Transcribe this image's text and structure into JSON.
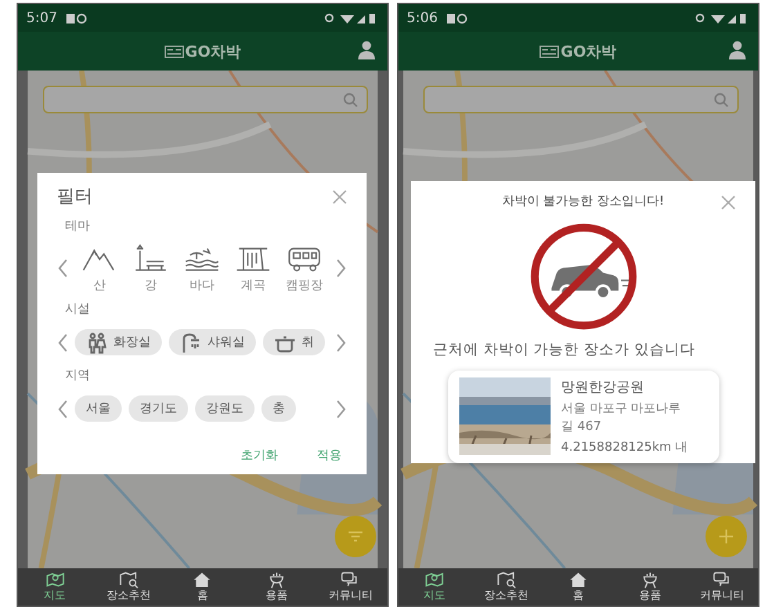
{
  "screens": [
    {
      "status_bar": {
        "time": "5:07"
      },
      "app_bar": {
        "title": "GO차박"
      },
      "fab": {
        "kind": "filter"
      },
      "bottom_nav": [
        {
          "label": "지도",
          "kind": "map",
          "selected": true
        },
        {
          "label": "장소추천",
          "kind": "places",
          "selected": false
        },
        {
          "label": "홈",
          "kind": "home",
          "selected": false
        },
        {
          "label": "용품",
          "kind": "gear",
          "selected": false
        },
        {
          "label": "커뮤니티",
          "kind": "chat",
          "selected": false
        }
      ],
      "dialog": {
        "kind": "filter",
        "title": "필터",
        "sections": [
          {
            "label": "테마",
            "kind": "themes",
            "items": [
              {
                "label": "산",
                "kind": "mountain"
              },
              {
                "label": "강",
                "kind": "river"
              },
              {
                "label": "바다",
                "kind": "sea"
              },
              {
                "label": "계곡",
                "kind": "valley"
              },
              {
                "label": "캠핑장",
                "kind": "camper"
              }
            ]
          },
          {
            "label": "시설",
            "kind": "chips",
            "items": [
              {
                "label": "화장실",
                "kind": "toilet"
              },
              {
                "label": "샤워실",
                "kind": "shower"
              },
              {
                "label": "취",
                "kind": "cooking"
              }
            ]
          },
          {
            "label": "지역",
            "kind": "chips",
            "items": [
              {
                "label": "서울"
              },
              {
                "label": "경기도"
              },
              {
                "label": "강원도"
              },
              {
                "label": "충"
              }
            ]
          }
        ],
        "buttons": [
          "초기화",
          "적용"
        ]
      }
    },
    {
      "status_bar": {
        "time": "5:06"
      },
      "app_bar": {
        "title": "GO차박"
      },
      "fab": {
        "kind": "add"
      },
      "bottom_nav": [
        {
          "label": "지도",
          "kind": "map",
          "selected": true
        },
        {
          "label": "장소추천",
          "kind": "places",
          "selected": false
        },
        {
          "label": "홈",
          "kind": "home",
          "selected": false
        },
        {
          "label": "용품",
          "kind": "gear",
          "selected": false
        },
        {
          "label": "커뮤니티",
          "kind": "chat",
          "selected": false
        }
      ],
      "dialog": {
        "kind": "notice",
        "title": "차박이 불가능한 장소입니다!",
        "message": "근처에 차박이 가능한 장소가 있습니다",
        "place": {
          "name": "망원한강공원",
          "address": "서울 마포구 마포나루길 467",
          "distance": "4.2158828125km 내"
        }
      }
    }
  ]
}
